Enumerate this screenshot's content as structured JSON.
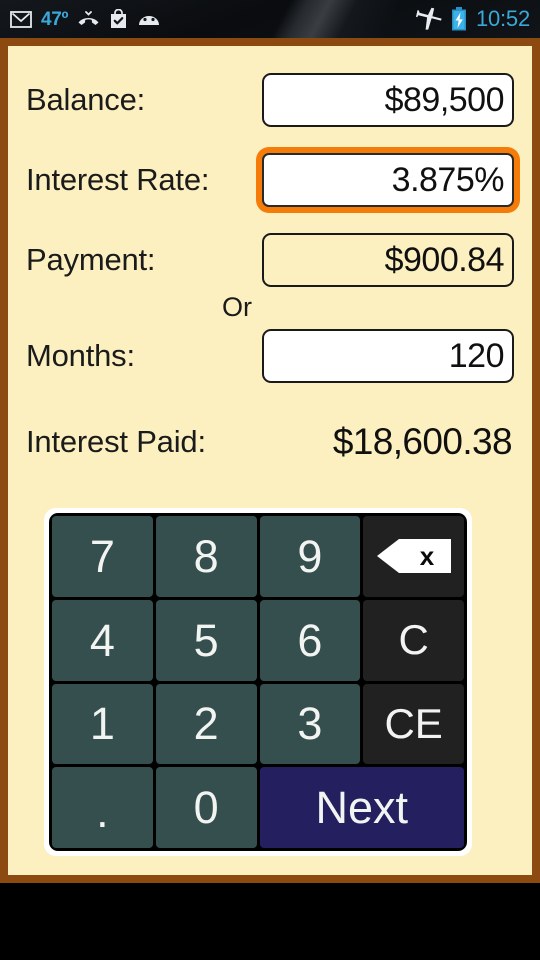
{
  "status_bar": {
    "temperature": "47º",
    "clock": "10:52",
    "left_icons": [
      "gmail-icon",
      "missed-call-icon",
      "play-store-icon",
      "android-icon"
    ],
    "right_icons": [
      "airplane-mode-icon",
      "battery-charging-icon"
    ],
    "text_color": "#3aa8d8"
  },
  "theme": {
    "page_background": "#fcf0c0",
    "frame_border": "#8d4a10",
    "focus_ring": "#f57c09",
    "key_number": "#344f4d",
    "key_function": "#212121",
    "key_next": "#242060"
  },
  "form": {
    "rows": [
      {
        "label": "Balance:",
        "value": "$89,500",
        "focused": false,
        "filled": true
      },
      {
        "label": "Interest Rate:",
        "value": "3.875%",
        "focused": true,
        "filled": true
      },
      {
        "label": "Payment:",
        "value": "$900.84",
        "focused": false,
        "filled": false
      },
      {
        "label": "Months:",
        "value": "120",
        "focused": false,
        "filled": true
      }
    ],
    "or_separator": "Or",
    "result": {
      "label": "Interest Paid:",
      "value": "$18,600.38"
    }
  },
  "keypad": {
    "keys": [
      {
        "label": "7",
        "type": "num"
      },
      {
        "label": "8",
        "type": "num"
      },
      {
        "label": "9",
        "type": "num"
      },
      {
        "label": "",
        "type": "backspace",
        "icon": "backspace-icon"
      },
      {
        "label": "4",
        "type": "num"
      },
      {
        "label": "5",
        "type": "num"
      },
      {
        "label": "6",
        "type": "num"
      },
      {
        "label": "C",
        "type": "fn"
      },
      {
        "label": "1",
        "type": "num"
      },
      {
        "label": "2",
        "type": "num"
      },
      {
        "label": "3",
        "type": "num"
      },
      {
        "label": "CE",
        "type": "fn"
      },
      {
        "label": ".",
        "type": "dot"
      },
      {
        "label": "0",
        "type": "num"
      },
      {
        "label": "Next",
        "type": "next"
      }
    ]
  }
}
